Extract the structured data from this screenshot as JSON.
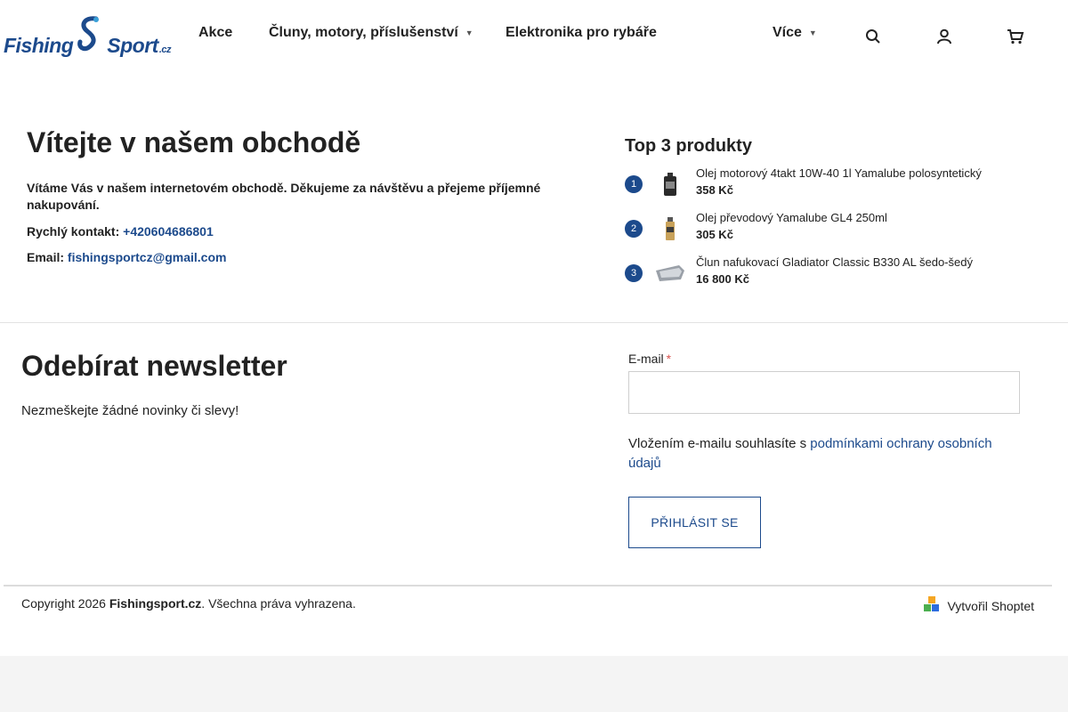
{
  "header": {
    "logo": {
      "word1": "Fishing",
      "word2": "Sport",
      "suffix": ".cz"
    },
    "nav": [
      {
        "label": "Akce"
      },
      {
        "label": "Čluny, motory, příslušenství"
      },
      {
        "label": "Elektronika pro rybáře"
      },
      {
        "label": "Více"
      }
    ],
    "icons": [
      "search-icon",
      "user-icon",
      "cart-icon"
    ]
  },
  "welcome": {
    "title": "Vítejte v našem obchodě",
    "intro": "Vítáme Vás v našem internetovém obchodě. Děkujeme za návštěvu a přejeme příjemné nakupování.",
    "contact_label": "Rychlý kontakt:",
    "phone": "+420604686801",
    "email_label": "Email:",
    "email": "fishingsportcz@gmail.com"
  },
  "top_products": {
    "title": "Top 3 produkty",
    "items": [
      {
        "rank": "1",
        "name": "Olej motorový 4takt 10W-40 1l Yamalube polosyntetický",
        "price": "358 Kč"
      },
      {
        "rank": "2",
        "name": "Olej převodový Yamalube GL4 250ml",
        "price": "305 Kč"
      },
      {
        "rank": "3",
        "name": "Člun nafukovací Gladiator Classic B330 AL šedo-šedý",
        "price": "16 800 Kč"
      }
    ]
  },
  "newsletter": {
    "title": "Odebírat newsletter",
    "subtitle": "Nezmeškejte žádné novinky či slevy!",
    "email_label": "E-mail",
    "required_mark": "*",
    "email_value": "",
    "consent_text": "Vložením e-mailu souhlasíte s ",
    "consent_link": "podmínkami ochrany osobních údajů",
    "submit_label": "PŘIHLÁSIT SE"
  },
  "footer": {
    "copyright_prefix": "Copyright 2026 ",
    "brand": "Fishingsport.cz",
    "copyright_suffix": ". Všechna práva vyhrazena.",
    "made_by": "Vytvořil Shoptet"
  },
  "colors": {
    "brand_blue": "#1c4a8c",
    "required_red": "#d9534f",
    "divider": "#dcdcdc"
  }
}
